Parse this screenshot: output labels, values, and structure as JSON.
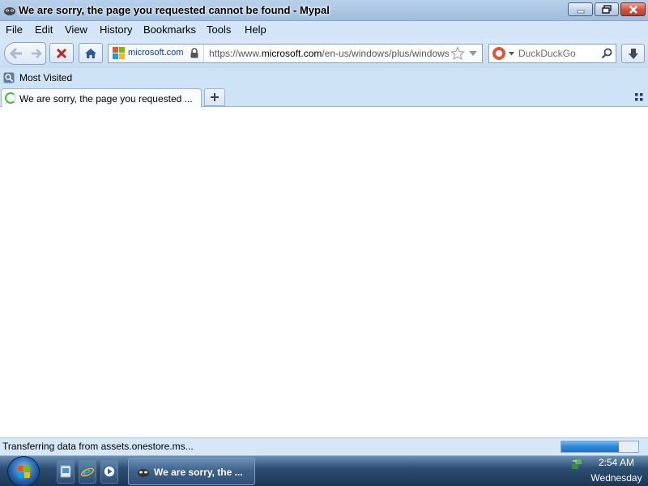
{
  "window": {
    "title": "We are sorry, the page you requested cannot be found - Mypal"
  },
  "menubar": {
    "items": [
      {
        "label": "File"
      },
      {
        "label": "Edit"
      },
      {
        "label": "View"
      },
      {
        "label": "History"
      },
      {
        "label": "Bookmarks"
      },
      {
        "label": "Tools"
      },
      {
        "label": "Help"
      }
    ]
  },
  "navbar": {
    "identity_host": "microsoft.com",
    "url_prefix": "https://www.",
    "url_domain": "microsoft.com",
    "url_path": "/en-us/windows/plus/windows",
    "search_engine": "DuckDuckGo"
  },
  "bookmarks": {
    "most_visited": "Most Visited"
  },
  "tabs": [
    {
      "label": "We are sorry, the page you requested ...",
      "loading": true
    }
  ],
  "status": {
    "text": "Transferring data from assets.onestore.ms...",
    "progress": 0.75
  },
  "taskbar": {
    "task_label": "We are sorry, the ...",
    "time": "2:54 AM",
    "day": "Wednesday"
  },
  "colors": {
    "chrome_bg": "#cfe3f6",
    "loading_green": "#3fbf3f",
    "close_red": "#c23a21",
    "progress_blue": "#2d87d8"
  },
  "icons": [
    "mypal-app-icon",
    "minimize-icon",
    "maximize-icon",
    "close-icon",
    "back-arrow-icon",
    "forward-arrow-icon",
    "stop-icon",
    "home-icon",
    "microsoft-logo-icon",
    "lock-icon",
    "bookmark-star-icon",
    "dropdown-arrow-icon",
    "duckduckgo-icon",
    "magnifier-icon",
    "download-arrow-icon",
    "most-visited-icon",
    "loading-spinner-icon",
    "plus-icon",
    "list-all-tabs-icon",
    "windows-start-icon",
    "show-desktop-icon",
    "internet-explorer-icon",
    "media-player-icon",
    "network-tray-icon"
  ]
}
